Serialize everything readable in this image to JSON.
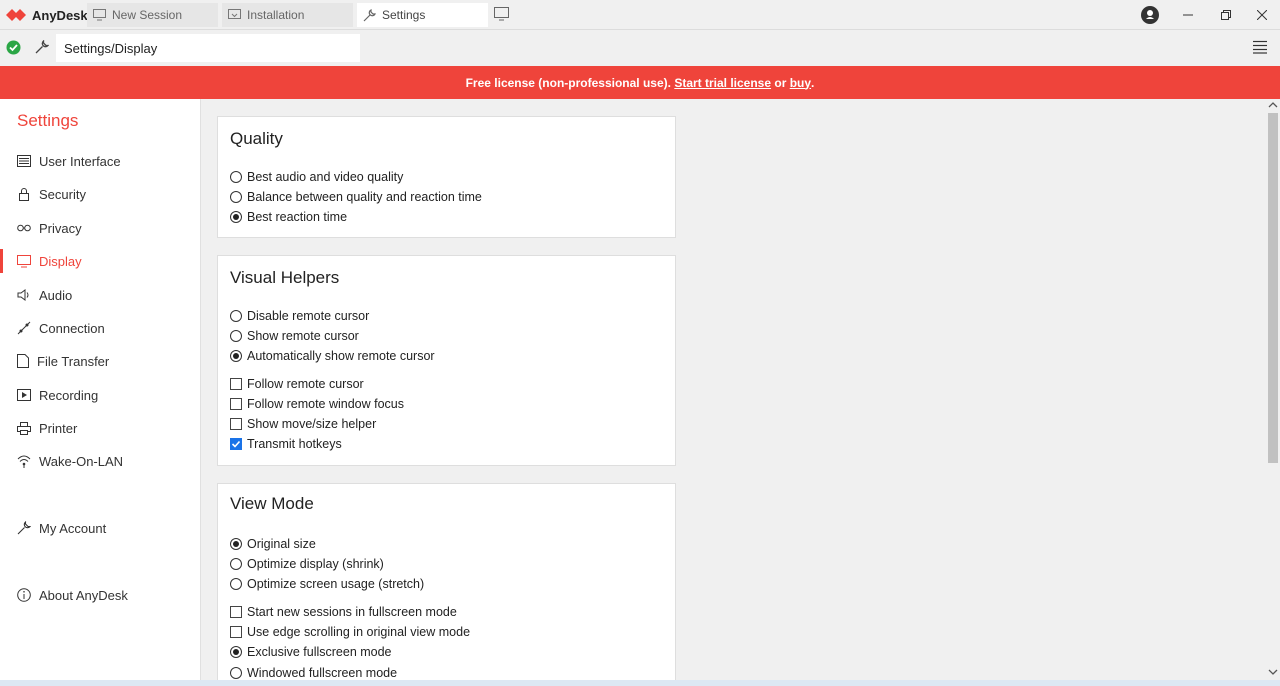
{
  "app": {
    "name": "AnyDesk",
    "brand_color": "#ef443b"
  },
  "tabs": [
    {
      "label": "New Session",
      "icon": "monitor-icon"
    },
    {
      "label": "Installation",
      "icon": "install-icon"
    },
    {
      "label": "Settings",
      "icon": "wrench-icon",
      "active": true
    }
  ],
  "address": {
    "path": "Settings/Display",
    "status": "connected-check-icon"
  },
  "banner": {
    "text_before": "Free license (non-professional use). ",
    "link_trial": "Start trial license",
    "text_mid": " or ",
    "link_buy": "buy",
    "text_end": "."
  },
  "sidebar": {
    "title": "Settings",
    "items": [
      {
        "label": "User Interface",
        "icon": "keyboard-icon"
      },
      {
        "label": "Security",
        "icon": "lock-icon"
      },
      {
        "label": "Privacy",
        "icon": "glasses-icon"
      },
      {
        "label": "Display",
        "icon": "monitor-icon",
        "active": true
      },
      {
        "label": "Audio",
        "icon": "speaker-icon"
      },
      {
        "label": "Connection",
        "icon": "connection-icon"
      },
      {
        "label": "File Transfer",
        "icon": "file-icon"
      },
      {
        "label": "Recording",
        "icon": "recording-icon"
      },
      {
        "label": "Printer",
        "icon": "printer-icon"
      },
      {
        "label": "Wake-On-LAN",
        "icon": "wifi-icon"
      }
    ],
    "account": {
      "label": "My Account",
      "icon": "wrench-icon"
    },
    "about": {
      "label": "About AnyDesk",
      "icon": "info-icon"
    }
  },
  "quality": {
    "title": "Quality",
    "options": [
      {
        "label": "Best audio and video quality",
        "selected": false
      },
      {
        "label": "Balance between quality and reaction time",
        "selected": false
      },
      {
        "label": "Best reaction time",
        "selected": true
      }
    ]
  },
  "visual_helpers": {
    "title": "Visual Helpers",
    "radios": [
      {
        "label": "Disable remote cursor",
        "selected": false
      },
      {
        "label": "Show remote cursor",
        "selected": false
      },
      {
        "label": "Automatically show remote cursor",
        "selected": true
      }
    ],
    "checks": [
      {
        "label": "Follow remote cursor",
        "checked": false
      },
      {
        "label": "Follow remote window focus",
        "checked": false
      },
      {
        "label": "Show move/size helper",
        "checked": false
      },
      {
        "label": "Transmit hotkeys",
        "checked": true
      }
    ]
  },
  "view_mode": {
    "title": "View Mode",
    "radios": [
      {
        "label": "Original size",
        "selected": true
      },
      {
        "label": "Optimize display (shrink)",
        "selected": false
      },
      {
        "label": "Optimize screen usage (stretch)",
        "selected": false
      }
    ],
    "checks": [
      {
        "label": "Start new sessions in fullscreen mode",
        "checked": false
      },
      {
        "label": "Use edge scrolling in original view mode",
        "checked": false
      }
    ],
    "radios2": [
      {
        "label": "Exclusive fullscreen mode",
        "selected": true
      },
      {
        "label": "Windowed fullscreen mode",
        "selected": false
      }
    ]
  }
}
